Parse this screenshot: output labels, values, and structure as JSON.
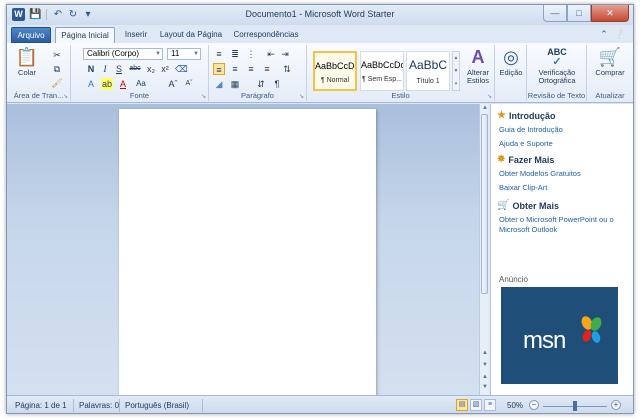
{
  "window": {
    "title": "Documento1 - Microsoft Word Starter",
    "app_icon": "W"
  },
  "quick_access": [
    {
      "icon": "save-icon",
      "glyph": "💾"
    },
    {
      "icon": "undo-icon",
      "glyph": "↶"
    },
    {
      "icon": "redo-icon",
      "glyph": "↻"
    },
    {
      "icon": "customize-qat-icon",
      "glyph": "▾"
    }
  ],
  "tabs": [
    "Arquivo",
    "Página Inicial",
    "Inserir",
    "Layout da Página",
    "Correspondências"
  ],
  "ribbon": {
    "clipboard": {
      "label": "Área de Tran...",
      "paste_label": "Colar"
    },
    "font": {
      "label": "Fonte",
      "font_name": "Calibri (Corpo)",
      "font_size": "11"
    },
    "paragraph": {
      "label": "Parágrafo"
    },
    "styles": {
      "label": "Estilo",
      "items": [
        {
          "sample": "AaBbCcDc",
          "name": "¶ Normal"
        },
        {
          "sample": "AaBbCcDc",
          "name": "¶ Sem Esp..."
        },
        {
          "sample": "AaBbC",
          "name": "Título 1"
        }
      ],
      "change_styles": "Alterar Estilos"
    },
    "editing": {
      "label": "Edição"
    },
    "proofing": {
      "button": "Verificação Ortográfica",
      "label": "Revisão de Texto"
    },
    "update": {
      "button": "Comprar",
      "label": "Atualizar"
    }
  },
  "side_pane": {
    "sections": [
      {
        "title": "Introdução",
        "links": [
          "Guia de Introdução",
          "Ajuda e Suporte"
        ]
      },
      {
        "title": "Fazer Mais",
        "links": [
          "Obter Modelos Gratuitos",
          "Baixar Clip-Art"
        ]
      },
      {
        "title": "Obter Mais",
        "links": [
          "Obter o Microsoft PowerPoint ou o Microsoft Outlook"
        ]
      }
    ],
    "ad_label": "Anúncio",
    "ad_text": "msn"
  },
  "status_bar": {
    "page": "Página: 1 de 1",
    "words": "Palavras: 0",
    "language": "Português (Brasil)",
    "zoom": "50%",
    "zoom_fraction": 0.5
  },
  "colors": {
    "accent": "#2b5797",
    "ribbon_bg": "#e4ecf7",
    "doc_bg": "#c6d6ea",
    "ad_bg": "#1f4e79"
  }
}
